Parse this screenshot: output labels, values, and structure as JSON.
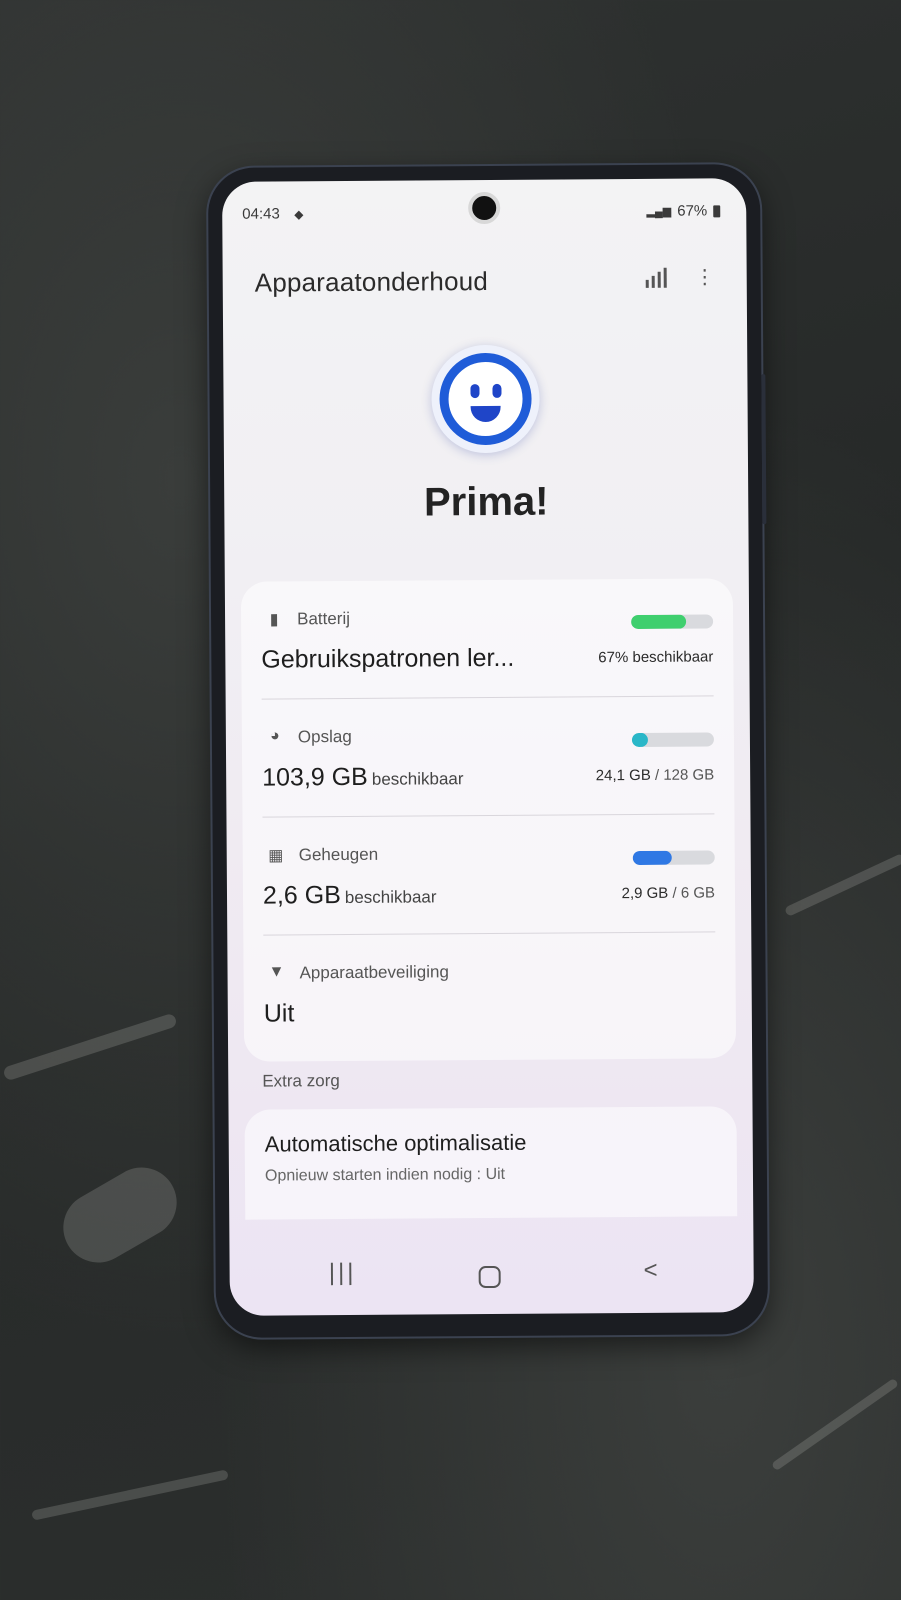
{
  "status_bar": {
    "time": "04:43",
    "battery": "67%"
  },
  "header": {
    "title": "Apparaatonderhoud"
  },
  "status_word": "Prima!",
  "rows": {
    "battery": {
      "label": "Batterij",
      "main": "Gebruikspatronen ler...",
      "right": "67% beschikbaar",
      "fill_percent": 67,
      "color": "#3fcf6e"
    },
    "storage": {
      "label": "Opslag",
      "main": "103,9 GB",
      "main_sub": "beschikbaar",
      "used": "24,1 GB",
      "total": "/ 128 GB",
      "fill_percent": 19,
      "color": "#2ab7c8"
    },
    "memory": {
      "label": "Geheugen",
      "main": "2,6 GB",
      "main_sub": "beschikbaar",
      "used": "2,9 GB",
      "total": "/ 6 GB",
      "fill_percent": 48,
      "color": "#2f78e4"
    },
    "security": {
      "label": "Apparaatbeveiliging",
      "main": "Uit"
    }
  },
  "extra": {
    "section_label": "Extra zorg",
    "title": "Automatische optimalisatie",
    "subtitle": "Opnieuw starten indien nodig : Uit"
  },
  "nav": {
    "recent_icon": "|||",
    "back_icon": "<"
  },
  "icons": {
    "battery": "battery-icon",
    "storage": "pie-icon",
    "memory": "chip-icon",
    "security": "shield-icon",
    "menu": "more-vertical-icon",
    "stats": "bar-chart-icon"
  }
}
